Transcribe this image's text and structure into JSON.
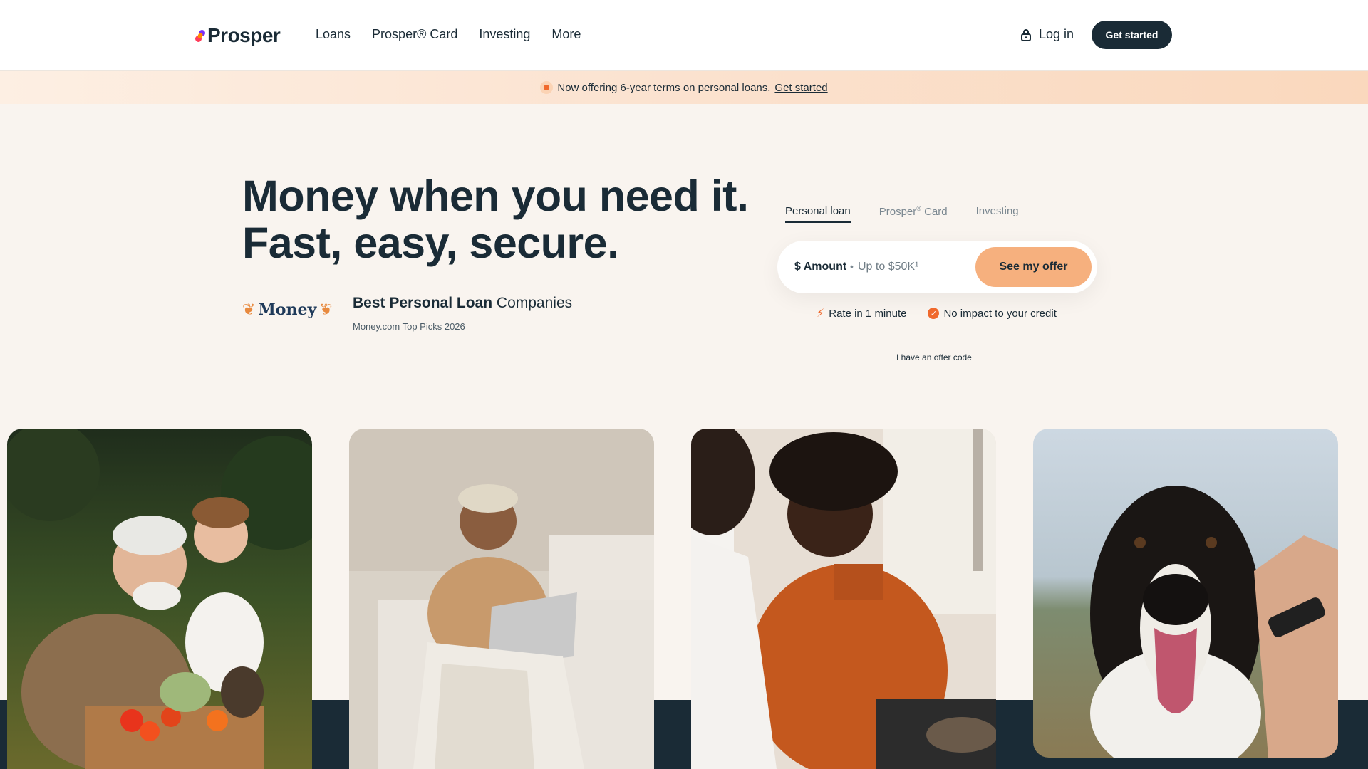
{
  "header": {
    "logo_text": "Prosper",
    "nav": [
      "Loans",
      "Prosper® Card",
      "Investing",
      "More"
    ],
    "login_label": "Log in",
    "cta_label": "Get started"
  },
  "banner": {
    "text": "Now offering 6-year terms on personal loans.",
    "link": "Get started"
  },
  "hero": {
    "title_line1": "Money when you need it.",
    "title_line2": "Fast, easy, secure."
  },
  "award": {
    "logo_text": "Money",
    "title_bold": "Best Personal Loan",
    "title_rest": " Companies",
    "subtitle": "Money.com Top Picks 2026"
  },
  "tabs": [
    {
      "label": "Personal loan",
      "sup": ""
    },
    {
      "label": "Prosper",
      "sup": "®",
      "rest": " Card"
    },
    {
      "label": "Investing",
      "sup": ""
    }
  ],
  "form": {
    "amount_label": "$ Amount",
    "separator": "•",
    "placeholder": "Up to $50K¹",
    "button": "See my offer"
  },
  "features": [
    "Rate in 1 minute",
    "No impact to your credit"
  ],
  "offer_code": "I have an offer code",
  "icons": [
    "lock-icon",
    "bolt-icon",
    "check-circle-icon",
    "laurel-icon"
  ],
  "colors": {
    "navy": "#1a2b36",
    "accent": "#f0692c",
    "peach": "#f6b07e"
  }
}
